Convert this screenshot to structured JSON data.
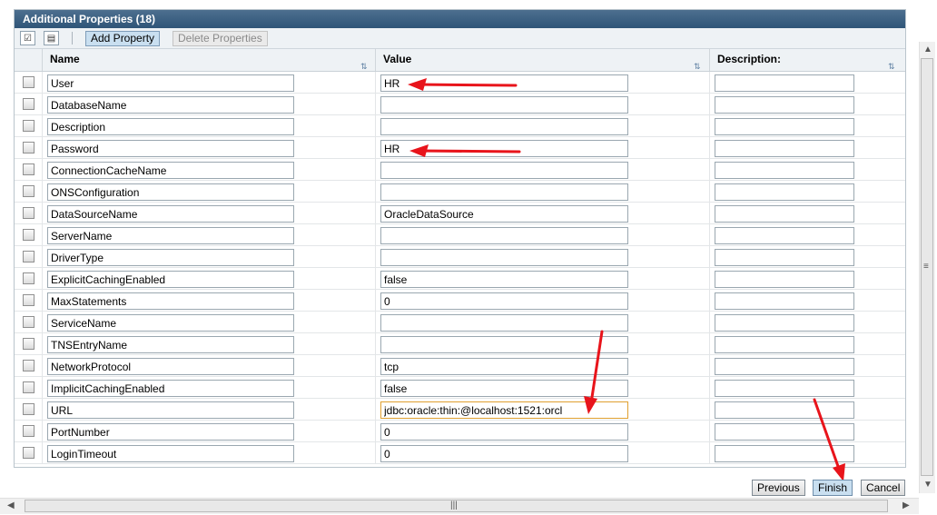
{
  "panel": {
    "title": "Additional Properties (18)"
  },
  "toolbar": {
    "select_all_icon": "select-all-checkbox-icon",
    "select_none_icon": "deselect-all-icon",
    "add_label": "Add Property",
    "delete_label": "Delete Properties"
  },
  "columns": {
    "name": "Name",
    "value": "Value",
    "description": "Description:"
  },
  "rows": [
    {
      "name": "User",
      "value": "HR",
      "description": ""
    },
    {
      "name": "DatabaseName",
      "value": "",
      "description": ""
    },
    {
      "name": "Description",
      "value": "",
      "description": ""
    },
    {
      "name": "Password",
      "value": "HR",
      "description": ""
    },
    {
      "name": "ConnectionCacheName",
      "value": "",
      "description": ""
    },
    {
      "name": "ONSConfiguration",
      "value": "",
      "description": ""
    },
    {
      "name": "DataSourceName",
      "value": "OracleDataSource",
      "description": ""
    },
    {
      "name": "ServerName",
      "value": "",
      "description": ""
    },
    {
      "name": "DriverType",
      "value": "",
      "description": ""
    },
    {
      "name": "ExplicitCachingEnabled",
      "value": "false",
      "description": ""
    },
    {
      "name": "MaxStatements",
      "value": "0",
      "description": ""
    },
    {
      "name": "ServiceName",
      "value": "",
      "description": ""
    },
    {
      "name": "TNSEntryName",
      "value": "",
      "description": ""
    },
    {
      "name": "NetworkProtocol",
      "value": "tcp",
      "description": ""
    },
    {
      "name": "ImplicitCachingEnabled",
      "value": "false",
      "description": ""
    },
    {
      "name": "URL",
      "value": "jdbc:oracle:thin:@localhost:1521:orcl",
      "description": ""
    },
    {
      "name": "PortNumber",
      "value": "0",
      "description": ""
    },
    {
      "name": "LoginTimeout",
      "value": "0",
      "description": ""
    }
  ],
  "footer": {
    "previous": "Previous",
    "finish": "Finish",
    "cancel": "Cancel"
  },
  "colors": {
    "title_bar": "#3d6285",
    "annotation_arrow": "#e8141b",
    "finish_bg": "#c9dff0"
  }
}
